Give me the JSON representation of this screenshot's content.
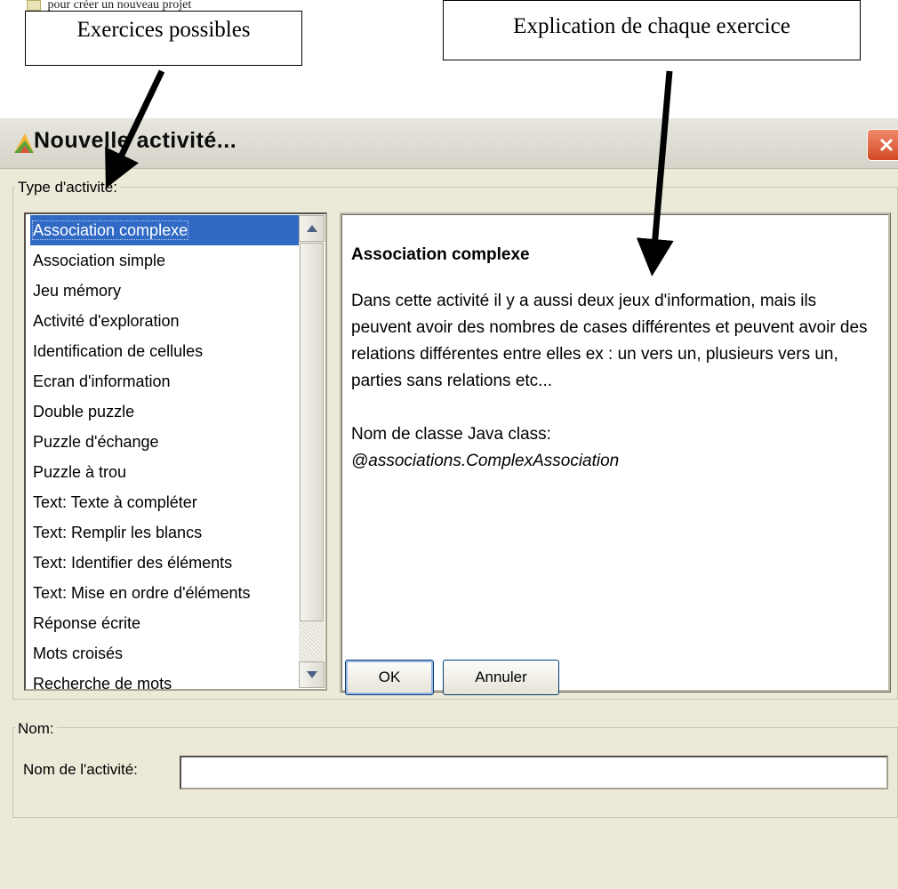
{
  "annotations": {
    "top_partial_text": "pour créer un nouveau projet",
    "callout_left": "Exercices possibles",
    "callout_right": "Explication de chaque exercice"
  },
  "window": {
    "title": "Nouvelle activité...",
    "close_icon": "close-icon"
  },
  "activity_type": {
    "legend": "Type d'activité:",
    "selected_index": 0,
    "items": [
      "Association complexe",
      "Association simple",
      "Jeu mémory",
      "Activité d'exploration",
      "Identification de cellules",
      "Ecran d'information",
      "Double puzzle",
      "Puzzle d'échange",
      "Puzzle à trou",
      "Text: Texte à compléter",
      "Text: Remplir les blancs",
      "Text: Identifier des éléments",
      "Text: Mise en ordre d'éléments",
      "Réponse écrite",
      "Mots croisés",
      "Recherche de mots"
    ]
  },
  "description": {
    "title": "Association complexe",
    "body": "Dans cette activité il y a aussi deux jeux d'information, mais ils peuvent avoir des nombres de cases différentes et peuvent avoir des relations différentes entre elles ex : un vers un, plusieurs vers un, parties sans relations etc...",
    "class_label": "Nom de classe Java class:",
    "class_name": "@associations.ComplexAssociation"
  },
  "name_group": {
    "legend": "Nom:",
    "label": "Nom de l'activité:",
    "value": "",
    "placeholder": ""
  },
  "buttons": {
    "ok": "OK",
    "cancel": "Annuler"
  },
  "colors": {
    "selection": "#316ac5",
    "dialog_bg": "#ece9d8",
    "close_button": "#d44a26"
  }
}
